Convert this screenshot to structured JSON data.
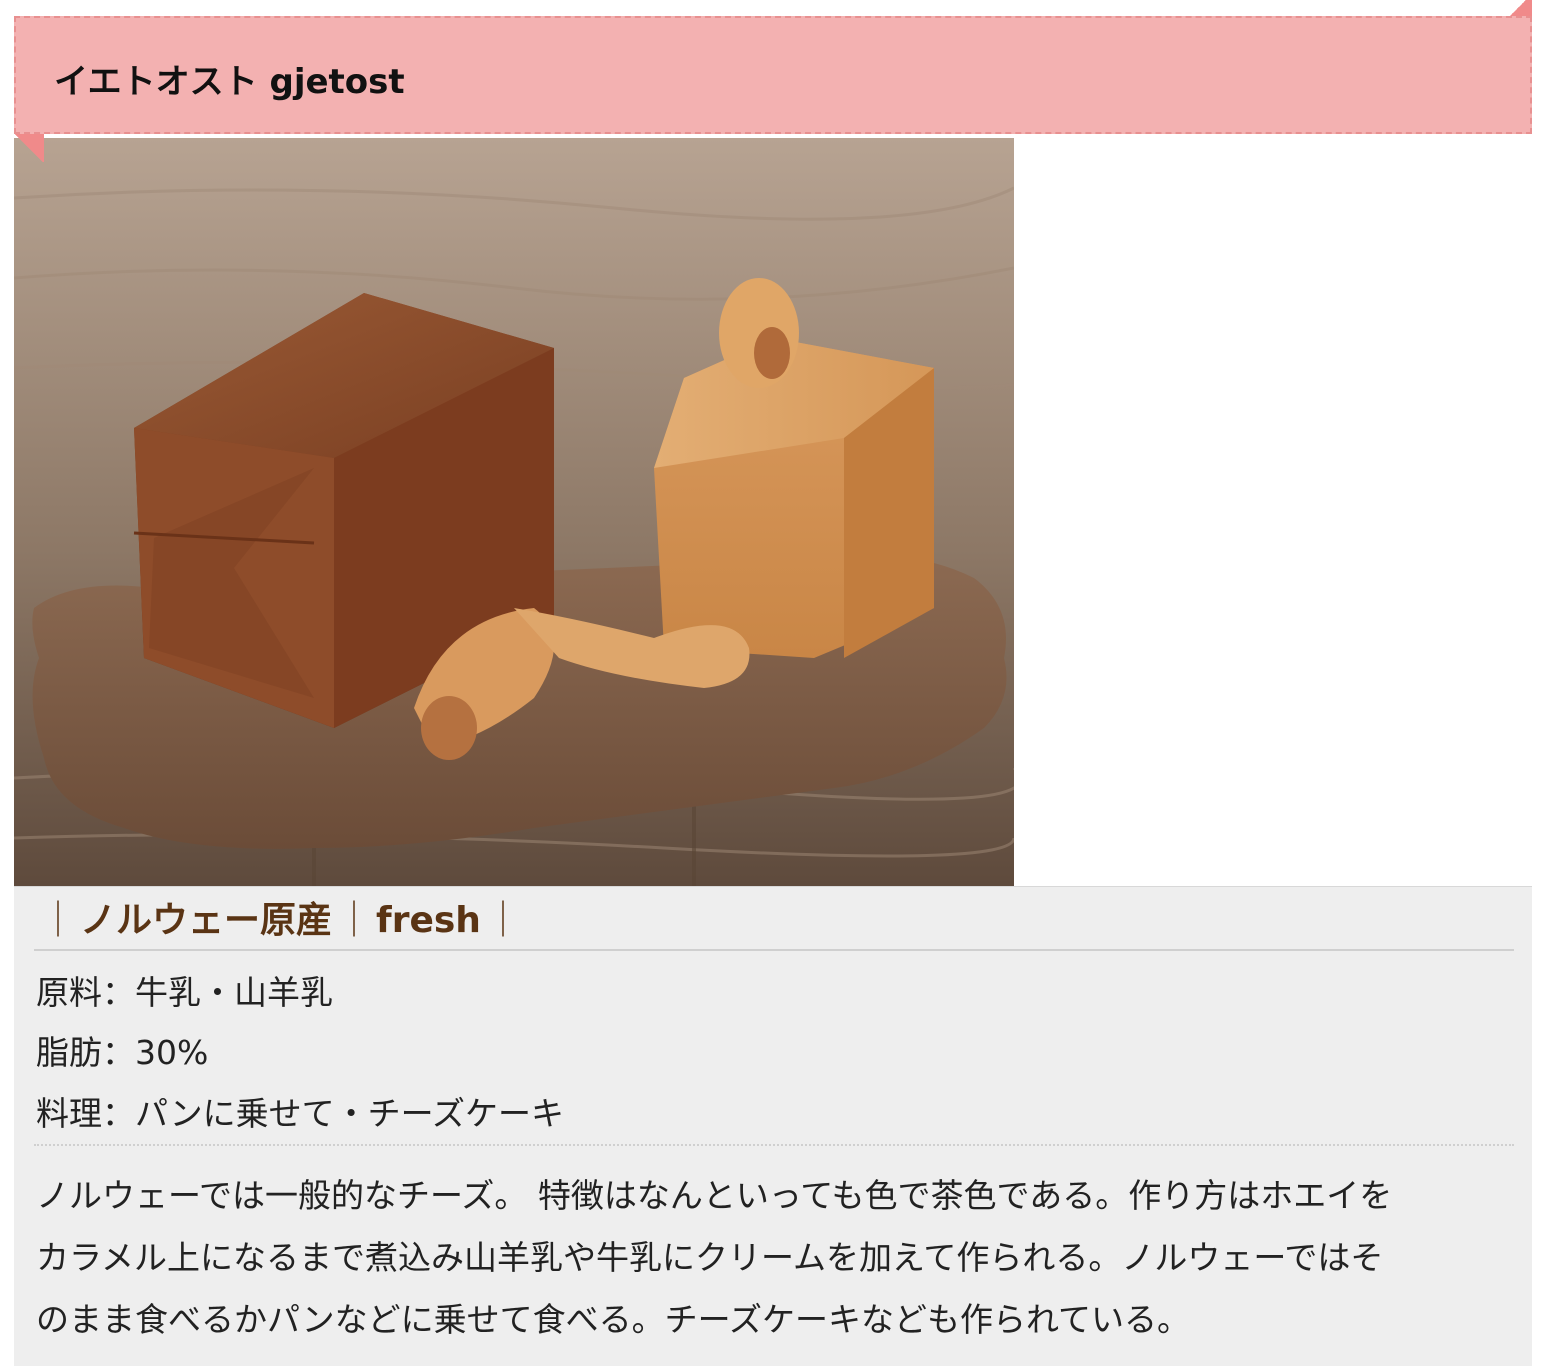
{
  "header": {
    "title": "イエトオスト gjetost"
  },
  "photo": {
    "alt": "gjetost-cheese-photo"
  },
  "tagline": {
    "origin": "ノルウェー原産",
    "type": "fresh",
    "separator": "｜"
  },
  "specs": [
    "原料：牛乳・山羊乳",
    "脂肪：30%",
    "料理：パンに乗せて・チーズケーキ"
  ],
  "description_lines": [
    "ノルウェーでは一般的なチーズ。 特徴はなんといっても色で茶色である。作り方はホエイを",
    "カラメル上になるまで煮込み山羊乳や牛乳にクリームを加えて作られる。ノルウェーではそ",
    "のまま食べるかパンなどに乗せて食べる。チーズケーキなども作られている。"
  ],
  "colors": {
    "ribbon": "#f3b1b1",
    "ribbon_fold": "#f08a8a",
    "panel": "#eeeeee",
    "tagline_text": "#5a3414"
  }
}
